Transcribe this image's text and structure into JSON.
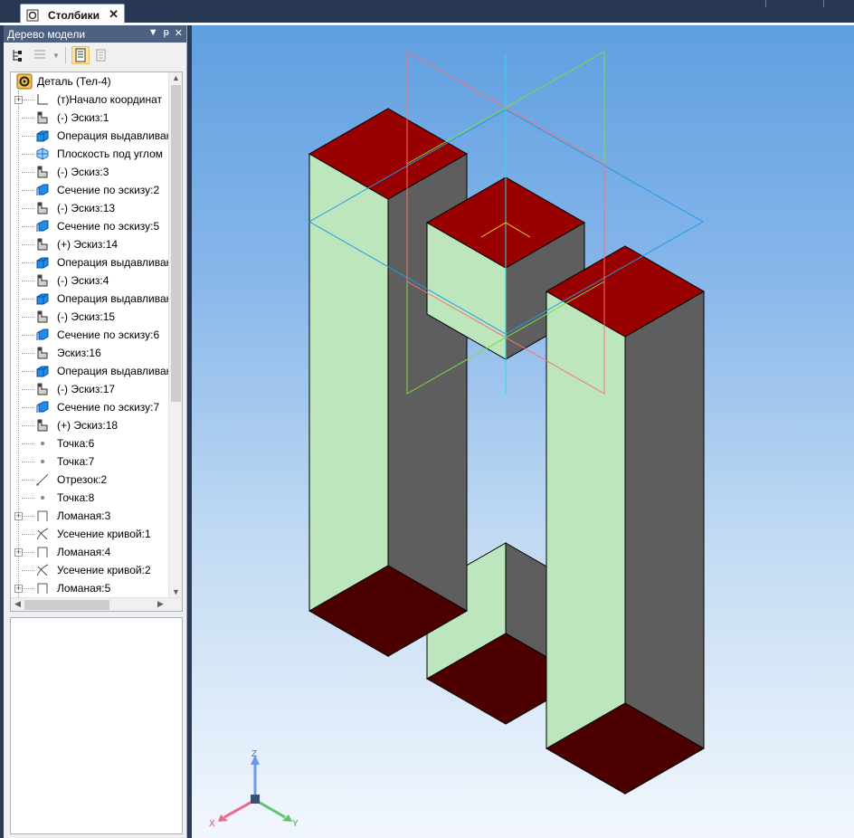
{
  "document_tab": {
    "title": "Столбики",
    "close": "✕"
  },
  "panel": {
    "title": "Дерево модели",
    "controls": {
      "dropdown": "▼",
      "pin": "ᵽ",
      "close": "✕"
    }
  },
  "tree": {
    "root": "Деталь (Тел-4)",
    "items": [
      {
        "label": "(т)Начало координат",
        "icon": "origin-icon",
        "expand": true
      },
      {
        "label": "(-) Эскиз:1",
        "icon": "sketch-icon",
        "expand": false
      },
      {
        "label": "Операция выдавливания",
        "icon": "extrude-icon",
        "expand": false
      },
      {
        "label": "Плоскость под углом",
        "icon": "plane-icon",
        "expand": false
      },
      {
        "label": "(-) Эскиз:3",
        "icon": "sketch-icon",
        "expand": false
      },
      {
        "label": "Сечение по эскизу:2",
        "icon": "section-icon",
        "expand": false
      },
      {
        "label": "(-) Эскиз:13",
        "icon": "sketch-icon",
        "expand": false
      },
      {
        "label": "Сечение по эскизу:5",
        "icon": "section-icon",
        "expand": false
      },
      {
        "label": "(+) Эскиз:14",
        "icon": "sketch-icon",
        "expand": false
      },
      {
        "label": "Операция выдавливания",
        "icon": "extrude-icon",
        "expand": false
      },
      {
        "label": "(-) Эскиз:4",
        "icon": "sketch-icon",
        "expand": false
      },
      {
        "label": "Операция выдавливания",
        "icon": "extrude-icon",
        "expand": false
      },
      {
        "label": "(-) Эскиз:15",
        "icon": "sketch-icon",
        "expand": false
      },
      {
        "label": "Сечение по эскизу:6",
        "icon": "section-icon",
        "expand": false
      },
      {
        "label": "Эскиз:16",
        "icon": "sketch-icon",
        "expand": false
      },
      {
        "label": "Операция выдавливания",
        "icon": "extrude-icon",
        "expand": false
      },
      {
        "label": "(-) Эскиз:17",
        "icon": "sketch-icon",
        "expand": false
      },
      {
        "label": "Сечение по эскизу:7",
        "icon": "section-icon",
        "expand": false
      },
      {
        "label": "(+) Эскиз:18",
        "icon": "sketch-icon",
        "expand": false
      },
      {
        "label": "Точка:6",
        "icon": "point-icon",
        "expand": false
      },
      {
        "label": "Точка:7",
        "icon": "point-icon",
        "expand": false
      },
      {
        "label": "Отрезок:2",
        "icon": "segment-icon",
        "expand": false
      },
      {
        "label": "Точка:8",
        "icon": "point-icon",
        "expand": false
      },
      {
        "label": "Ломаная:3",
        "icon": "polyline-icon",
        "expand": true
      },
      {
        "label": "Усечение кривой:1",
        "icon": "trim-icon",
        "expand": false
      },
      {
        "label": "Ломаная:4",
        "icon": "polyline-icon",
        "expand": true
      },
      {
        "label": "Усечение кривой:2",
        "icon": "trim-icon",
        "expand": false
      },
      {
        "label": "Ломаная:5",
        "icon": "polyline-icon",
        "expand": true
      }
    ]
  },
  "triad": {
    "x": "X",
    "y": "Y",
    "z": "Z"
  },
  "colors": {
    "top_face": "#990000",
    "bottom_face": "#4d0000",
    "front_face": "#bde6bd",
    "side_face": "#5e5e5e",
    "plane_xy": "#1e9be8",
    "plane_green": "#7fdc3a",
    "plane_red": "#ff7070",
    "axis_cyan": "#2fd8e8"
  }
}
